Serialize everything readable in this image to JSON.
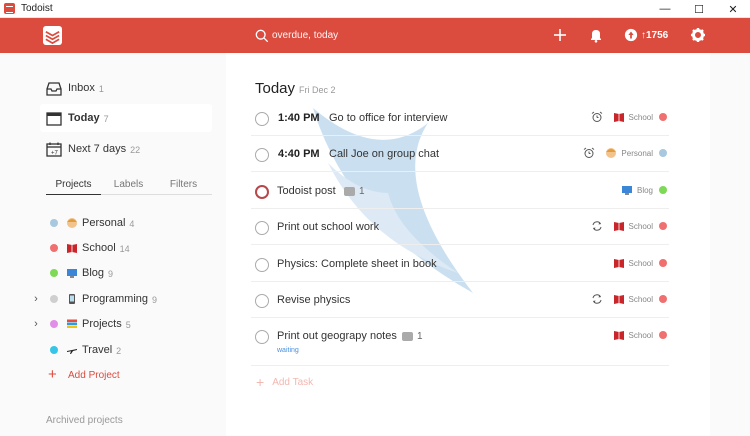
{
  "window": {
    "title": "Todoist",
    "minimize": "—",
    "maximize": "☐",
    "close": "✕"
  },
  "topbar": {
    "search_text": "overdue, today",
    "karma": "↑1756"
  },
  "sidebar": {
    "nav": [
      {
        "label": "Inbox",
        "count": "1"
      },
      {
        "label": "Today",
        "count": "7"
      },
      {
        "label": "Next 7 days",
        "count": "22"
      }
    ],
    "tabs": [
      "Projects",
      "Labels",
      "Filters"
    ],
    "projects": [
      {
        "name": "Personal",
        "count": "4",
        "color": "#a8c8e0",
        "expandable": false
      },
      {
        "name": "School",
        "count": "14",
        "color": "#f07070",
        "expandable": false
      },
      {
        "name": "Blog",
        "count": "9",
        "color": "#7ed957",
        "expandable": false
      },
      {
        "name": "Programming",
        "count": "9",
        "color": "#cfcfcf",
        "expandable": true
      },
      {
        "name": "Projects",
        "count": "5",
        "color": "#e18ee8",
        "expandable": true
      },
      {
        "name": "Travel",
        "count": "2",
        "color": "#36c5e8",
        "expandable": false
      }
    ],
    "add_project": "Add Project",
    "archived": "Archived projects"
  },
  "main": {
    "title": "Today",
    "date": "Fri Dec 2",
    "tasks": [
      {
        "time": "1:40 PM",
        "content": "Go to office for interview",
        "icon": "alarm-icon",
        "project": "School",
        "color": "#f07070"
      },
      {
        "time": "4:40 PM",
        "content": "Call Joe on group chat",
        "icon": "alarm-icon",
        "project": "Personal",
        "color": "#a8c8e0"
      },
      {
        "content": "Todoist post",
        "comments": "1",
        "project": "Blog",
        "color": "#7ed957"
      },
      {
        "content": "Print out school work",
        "icon": "recurring-icon",
        "project": "School",
        "color": "#f07070"
      },
      {
        "content": "Physics: Complete sheet in book",
        "project": "School",
        "color": "#f07070"
      },
      {
        "content": "Revise physics",
        "icon": "recurring-icon",
        "project": "School",
        "color": "#f07070"
      },
      {
        "content": "Print out geograpy notes",
        "comments": "1",
        "label": "waiting",
        "project": "School",
        "color": "#f07070"
      }
    ],
    "add_task": "Add Task"
  },
  "colors": {
    "brand": "#db4c3f"
  }
}
